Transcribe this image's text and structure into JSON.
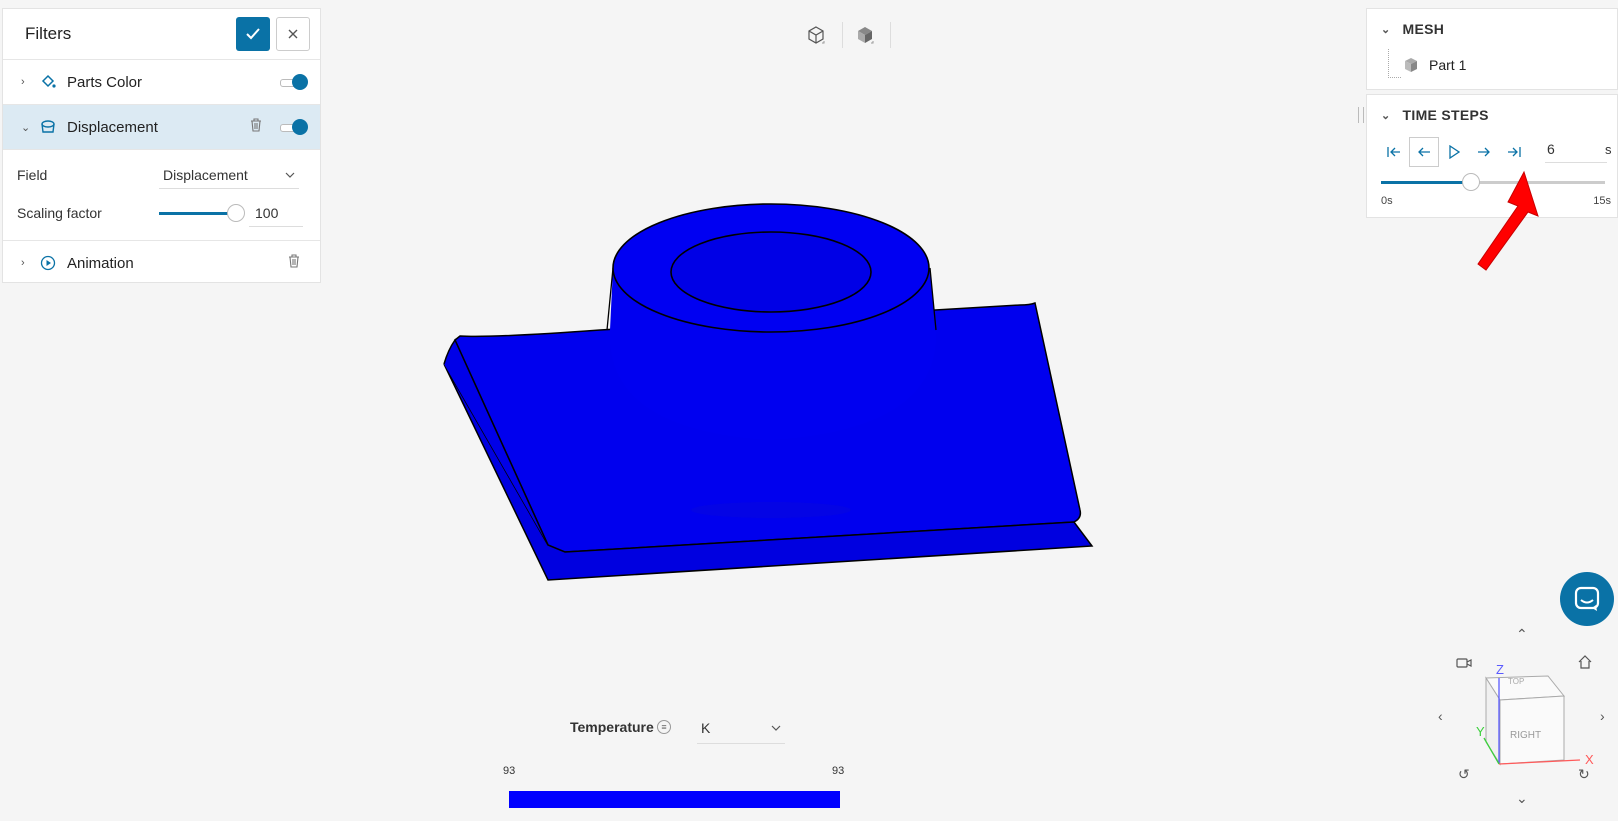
{
  "filters": {
    "title": "Filters",
    "items": [
      {
        "label": "Parts Color",
        "enabled": true
      },
      {
        "label": "Displacement",
        "enabled": true
      },
      {
        "label": "Animation"
      }
    ],
    "displacement": {
      "field_label": "Field",
      "field_value": "Displacement",
      "scaling_label": "Scaling factor",
      "scaling_value": "100"
    }
  },
  "viewer_toolbar": {
    "icons": [
      "wireframe-cube-icon",
      "solid-cube-icon"
    ]
  },
  "mesh": {
    "title": "MESH",
    "parts": [
      "Part 1"
    ]
  },
  "time_steps": {
    "title": "TIME STEPS",
    "value": "6",
    "unit": "s",
    "min_label": "0s",
    "max_label": "15s",
    "progress": 0.4
  },
  "legend": {
    "variable": "Temperature",
    "unit": "K",
    "min": "93",
    "max": "93",
    "color": "#0000ff"
  },
  "nav_cube": {
    "faces": [
      "TOP",
      "RIGHT"
    ],
    "axes": [
      "Z",
      "Y",
      "X"
    ]
  },
  "colors": {
    "accent": "#0a72a6",
    "model": "#0000f0",
    "annotation_arrow": "#ff0000"
  }
}
